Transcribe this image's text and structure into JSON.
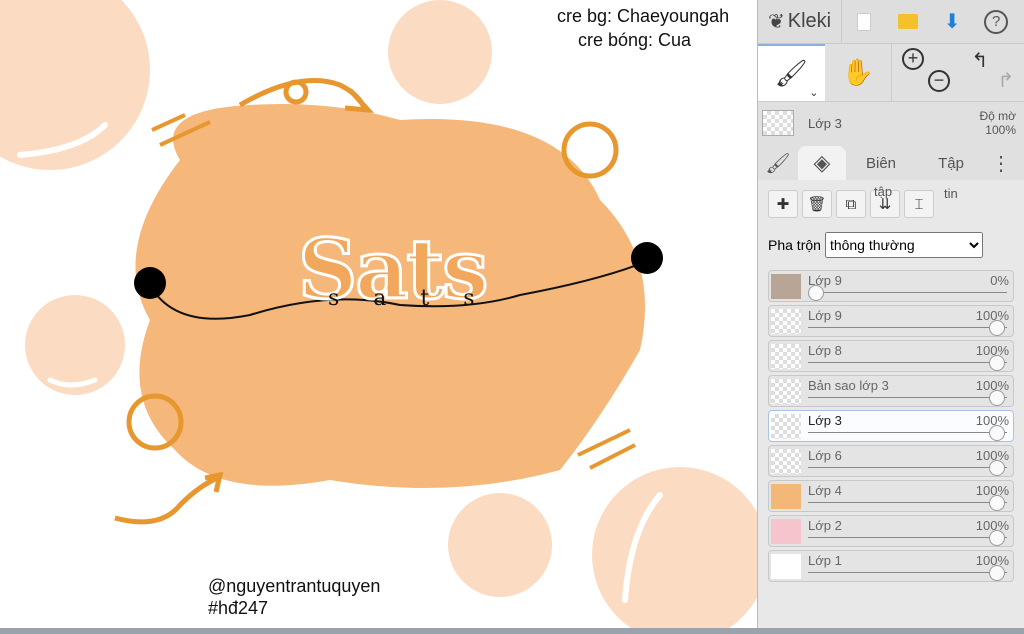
{
  "canvas": {
    "credit_bg": "cre bg: Chaeyoungah",
    "credit_shadow": "cre bóng: Cua",
    "title_text": "Sats",
    "string_letters": [
      "s",
      "a",
      "t",
      "s"
    ],
    "author": "@nguyentrantuquyen",
    "hashtag": "#hđ247"
  },
  "toolbar": {
    "logo": "Kleki",
    "icons": [
      "new-file-icon",
      "open-folder-icon",
      "download-icon",
      "help-icon"
    ]
  },
  "tools": {
    "brush": "brush-icon",
    "hand": "hand-icon",
    "zoom_in": "+",
    "zoom_out": "−",
    "undo": "undo-icon",
    "redo": "redo-icon"
  },
  "current_layer": {
    "name": "Lớp 3",
    "opacity_label": "Độ mờ",
    "opacity": "100%"
  },
  "tabs": {
    "brush": "brush-tab",
    "layers": "layers-tab",
    "edit": "Biên",
    "file": "Tập",
    "more": "⋮"
  },
  "layer_buttons": {
    "overflow_1": "tập",
    "overflow_2": "tin"
  },
  "blend": {
    "label": "Pha trộn",
    "value": "thông thường"
  },
  "layers": [
    {
      "name": "Lớp 9",
      "opacity": "0%",
      "value": 0,
      "thumb": "#b9a596"
    },
    {
      "name": "Lớp 9",
      "opacity": "100%",
      "value": 1
    },
    {
      "name": "Lớp 8",
      "opacity": "100%",
      "value": 1
    },
    {
      "name": "Bản sao lớp 3",
      "opacity": "100%",
      "value": 1
    },
    {
      "name": "Lớp 3",
      "opacity": "100%",
      "value": 1,
      "selected": true
    },
    {
      "name": "Lớp 6",
      "opacity": "100%",
      "value": 1
    },
    {
      "name": "Lớp 4",
      "opacity": "100%",
      "value": 1,
      "thumb": "#f3b877"
    },
    {
      "name": "Lớp 2",
      "opacity": "100%",
      "value": 1,
      "thumb": "#f6c4cc"
    },
    {
      "name": "Lớp 1",
      "opacity": "100%",
      "value": 1,
      "thumb": "#ffffff"
    }
  ],
  "colors": {
    "orange": "#f5b77a",
    "accent": "#e8962e",
    "bubble": "#fbdcc2"
  }
}
